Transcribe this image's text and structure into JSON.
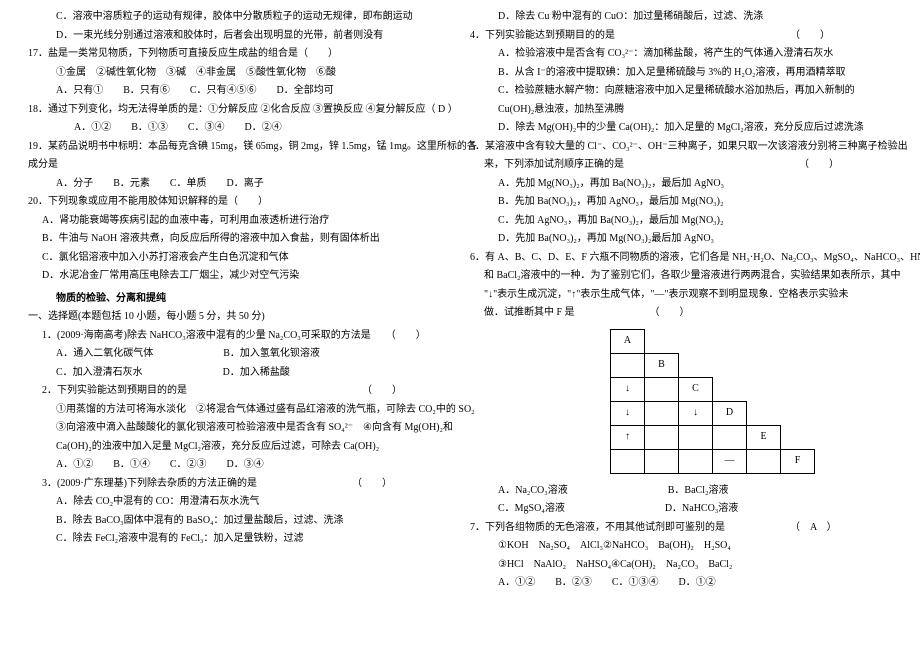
{
  "left": {
    "l1": "C．溶液中溶质粒子的运动有规律，胶体中分散质粒子的运动无规律，即布朗运动",
    "l2": "D．一束光线分别通过溶液和胶体时，后者会出现明显的光带，前者则没有",
    "q17": "17．盐是一类常见物质，下列物质可直接反应生成盐的组合是（　　）",
    "q17opts": "①金属　②碱性氧化物　③碱　④非金属　⑤酸性氧化物　⑥酸",
    "q17abcd": "A．只有①　　B．只有⑥　　C．只有④⑤⑥　　D．全部均可",
    "q18": "18．通过下列变化，均无法得单质的是：①分解反应 ②化合反应 ③置换反应 ④复分解反应（ D ）",
    "q18abcd": "A．①②　　B．①③　　C．③④　　D．②④",
    "q19": "19．某药品说明书中标明：本品每克含碘 15mg，镁 65mg，铜 2mg，锌 1.5mg，锰 1mg。这里所标的各",
    "q19b": "成分是",
    "q19abcd": "A．分子　　B．元素　　C．单质　　D．离子",
    "q20": "20．下列现象或应用不能用胶体知识解释的是（　　）",
    "q20a": "A．肾功能衰竭等疾病引起的血液中毒，可利用血液透析进行治疗",
    "q20b": "B．牛油与 NaOH 溶液共煮，向反应后所得的溶液中加入食盐，则有固体析出",
    "q20c": "C．氯化铝溶液中加入小苏打溶液会产生白色沉淀和气体",
    "q20d": "D．水泥冶金厂常用高压电除去工厂烟尘，减少对空气污染",
    "section": "物质的检验、分离和提纯",
    "sel": "一、选择题(本题包括 10 小题，每小题 5 分，共 50 分)",
    "s1": "1．(2009·海南高考)除去 NaHCO₃溶液中混有的少量 Na₂CO₃可采取的方法是　　（　　）",
    "s1ab": "A．通入二氧化碳气体　　　　　　　B．加入氢氧化钡溶液",
    "s1cd": "C．加入澄清石灰水　　　　　　　　D．加入稀盐酸",
    "s2": "2．下列实验能达到预期目的的是　　　　　　　　　　　　　　　　　　（　　）",
    "s2a": "①用蒸馏的方法可将海水淡化　②将混合气体通过盛有品红溶液的洗气瓶，可除去 CO₂中的 SO₂",
    "s2b": "③向溶液中滴入盐酸酸化的氯化钡溶液可检验溶液中是否含有 SO₄²⁻　④向含有 Mg(OH)₂和",
    "s2c": "Ca(OH)₂的浊液中加入足量 MgCl₂溶液，充分反应后过滤，可除去 Ca(OH)₂",
    "s2abcd": "A．①②　　B．①④　　C．②③　　D．③④",
    "s3": "3．(2009·广东理基)下列除去杂质的方法正确的是　　　　　　　　　　（　　）",
    "s3a": "A．除去 CO₂中混有的 CO：用澄清石灰水洗气",
    "s3b": "B．除去 BaCO₃固体中混有的 BaSO₄：加过量盐酸后，过滤、洗涤",
    "s3c": "C．除去 FeCl₂溶液中混有的 FeCl₃：加入足量铁粉，过滤"
  },
  "right": {
    "r0": "D．除去 Cu 粉中混有的 CuO：加过量稀硝酸后，过滤、洗涤",
    "q4": "4．下列实验能达到预期目的的是　　　　　　　　　　　　　　　　　　（　　）",
    "q4a": "A．检验溶液中是否含有 CO₃²⁻：滴加稀盐酸，将产生的气体通入澄清石灰水",
    "q4b": "B．从含 I⁻的溶液中提取碘：加入足量稀硫酸与 3%的 H₂O₂溶液，再用酒精萃取",
    "q4c": "C．检验蔗糖水解产物：向蔗糖溶液中加入足量稀硫酸水浴加热后，再加入新制的",
    "q4c2": "Cu(OH)₂悬浊液，加热至沸腾",
    "q4d": "D．除去 Mg(OH)₂中的少量 Ca(OH)₂：加入足量的 MgCl₂溶液，充分反应后过滤洗涤",
    "q5": "5．某溶液中含有较大量的 Cl⁻、CO₃²⁻、OH⁻三种离子，如果只取一次该溶液分别将三种离子检验出",
    "q5b": "来，下列添加试剂顺序正确的是　　　　　　　　　　　　　　　　　　（　　）",
    "q5A": "A．先加 Mg(NO₃)₂，再加 Ba(NO₃)₂，最后加 AgNO₃",
    "q5B": "B．先加 Ba(NO₃)₂，再加 AgNO₃，最后加 Mg(NO₃)₂",
    "q5C": "C．先加 AgNO₃，再加 Ba(NO₃)₂，最后加 Mg(NO₃)₂",
    "q5D": "D．先加 Ba(NO₃)₂，再加 Mg(NO₃)₂最后加 AgNO₃",
    "q6": "6．有 A、B、C、D、E、F 六瓶不同物质的溶液，它们各是 NH₃·H₂O、Na₂CO₃、MgSO₄、NaHCO₃、HNO₃",
    "q6b": "和 BaCl₂溶液中的一种．为了鉴别它们，各取少量溶液进行两两混合，实验结果如表所示，其中",
    "q6c": "\"↓\"表示生成沉淀，\"↑\"表示生成气体，\"—\"表示观察不到明显现象．空格表示实验未",
    "q6d": "做．试推断其中 F 是　　　　　　　　（　　）",
    "q6tab": {
      "A": "A",
      "B": "B",
      "C": "C",
      "D": "D",
      "E": "E",
      "F": "F",
      "down": "↓",
      "up": "↑",
      "dash": "—"
    },
    "q6ab": "A．Na₂CO₃溶液　　　　　　　　　　B．BaCl₂溶液",
    "q6cd": "C．MgSO₄溶液　　　　　　　　　　D．NaHCO₃溶液",
    "q7": "7．下列各组物质的无色溶液，不用其他试剂即可鉴别的是　　　　　　　（　A　）",
    "q7a": "①KOH　Na₂SO₄　AlCl₃②NaHCO₃　Ba(OH)₂　H₂SO₄",
    "q7b": "③HCl　NaAlO₂　NaHSO₄④Ca(OH)₂　Na₂CO₃　BaCl₂",
    "q7abcd": "A．①②　　B．②③　　C．①③④　　D．①②"
  }
}
